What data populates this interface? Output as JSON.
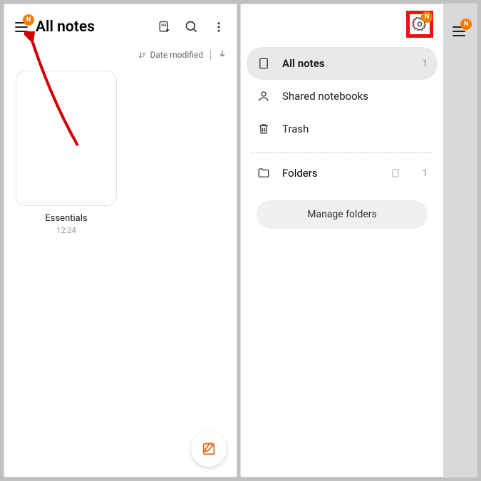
{
  "left": {
    "title": "All notes",
    "badge": "N",
    "sort_label": "Date modified",
    "note": {
      "title": "Essentials",
      "time": "12:24"
    }
  },
  "right": {
    "badge": "N",
    "menu": {
      "all_notes": {
        "label": "All notes",
        "count": "1"
      },
      "shared": {
        "label": "Shared notebooks"
      },
      "trash": {
        "label": "Trash"
      },
      "folders": {
        "label": "Folders",
        "count": "1"
      }
    },
    "manage_label": "Manage folders"
  }
}
